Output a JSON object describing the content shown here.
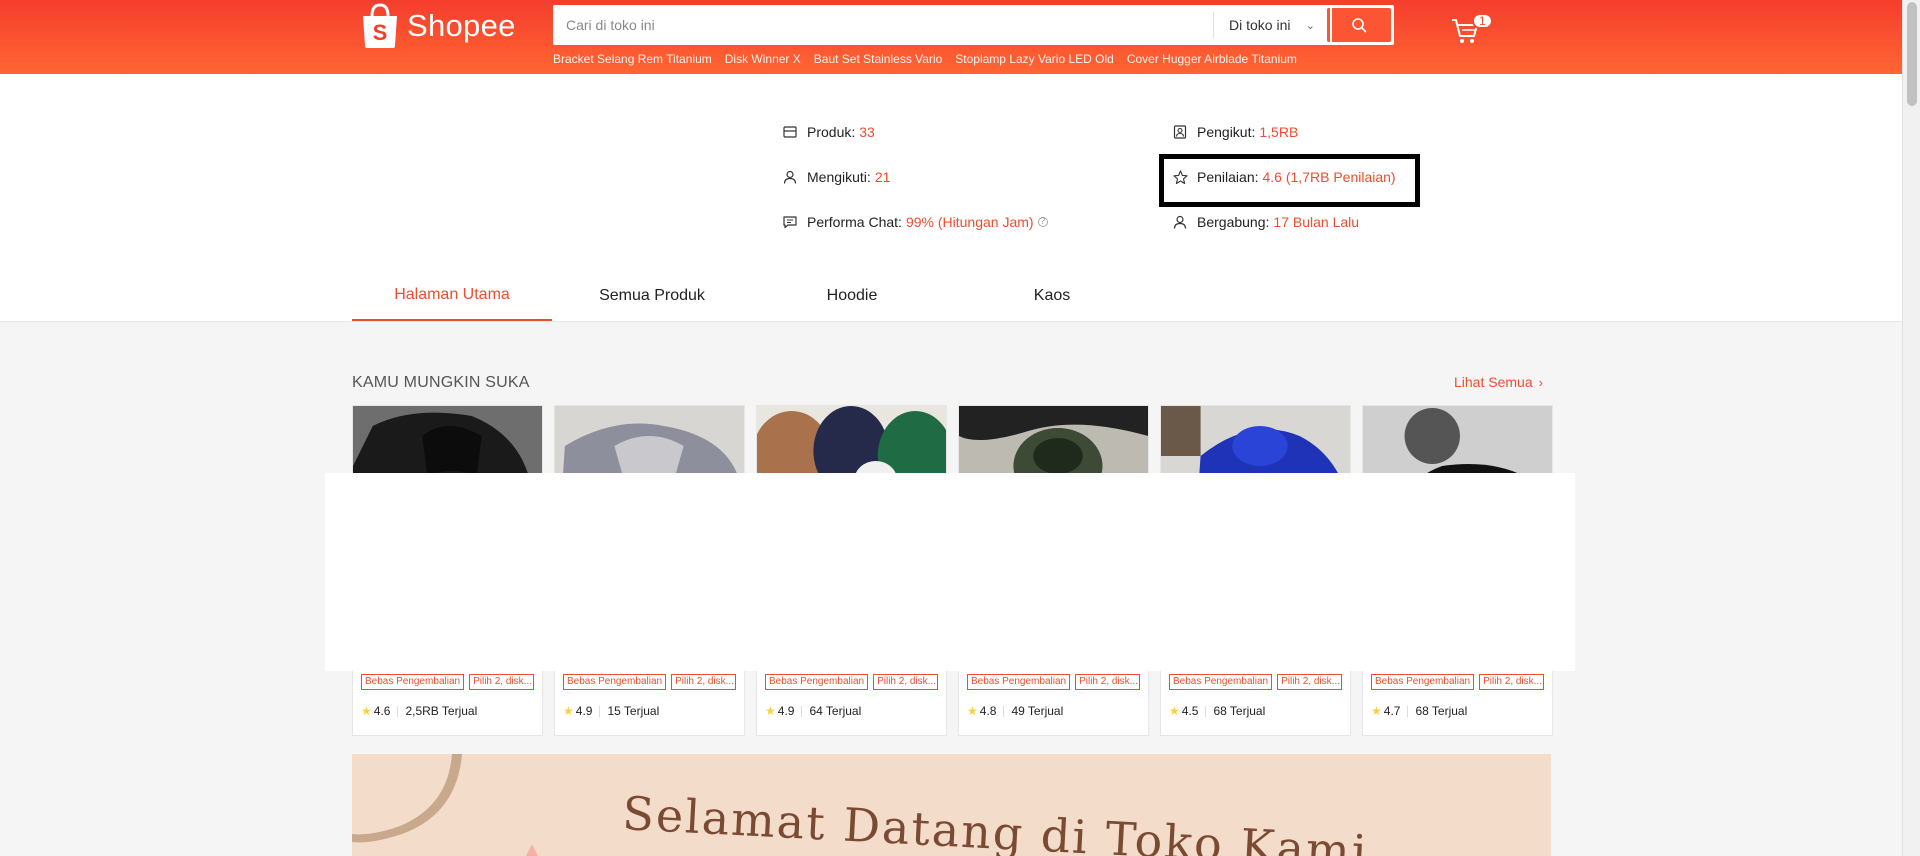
{
  "brand": {
    "name": "Shopee",
    "primary_color": "#ee4d2d"
  },
  "search": {
    "placeholder": "Cari di toko ini",
    "scope_label": "Di toko ini",
    "suggestions": [
      "Bracket Selang Rem Titanium",
      "Disk Winner X",
      "Baut Set Stainless Vario",
      "Stoplamp Lazy Vario LED Old",
      "Cover Hugger Airblade Titanium"
    ]
  },
  "cart": {
    "count": "1"
  },
  "shop_stats": {
    "products": {
      "label": "Produk:",
      "value": "33",
      "icon": "store-icon"
    },
    "following": {
      "label": "Mengikuti:",
      "value": "21",
      "icon": "user-icon"
    },
    "chat_performance": {
      "label": "Performa Chat:",
      "value": "99% (Hitungan Jam)",
      "icon": "chat-icon"
    },
    "followers": {
      "label": "Pengikut:",
      "value": "1,5RB",
      "icon": "followers-icon"
    },
    "rating": {
      "label": "Penilaian:",
      "value": "4.6 (1,7RB Penilaian)",
      "icon": "star-outline-icon"
    },
    "joined": {
      "label": "Bergabung:",
      "value": "17 Bulan Lalu",
      "icon": "user-join-icon"
    }
  },
  "tabs": [
    {
      "label": "Halaman Utama",
      "active": true
    },
    {
      "label": "Semua Produk",
      "active": false
    },
    {
      "label": "Hoodie",
      "active": false
    },
    {
      "label": "Kaos",
      "active": false
    }
  ],
  "recommendations": {
    "title": "KAMU MUNGKIN SUKA",
    "see_all": "Lihat Semua",
    "products": [
      {
        "rating": "4.6",
        "sold": "2,5RB Terjual",
        "tag1": "Bebas Pengembalian",
        "tag2": "Pilih 2, disk..."
      },
      {
        "rating": "4.9",
        "sold": "15 Terjual",
        "tag1": "Bebas Pengembalian",
        "tag2": "Pilih 2, disk..."
      },
      {
        "rating": "4.9",
        "sold": "64 Terjual",
        "tag1": "Bebas Pengembalian",
        "tag2": "Pilih 2, disk..."
      },
      {
        "rating": "4.8",
        "sold": "49 Terjual",
        "tag1": "Bebas Pengembalian",
        "tag2": "Pilih 2, disk..."
      },
      {
        "rating": "4.5",
        "sold": "68 Terjual",
        "tag1": "Bebas Pengembalian",
        "tag2": "Pilih 2, disk..."
      },
      {
        "rating": "4.7",
        "sold": "68 Terjual",
        "tag1": "Bebas Pengembalian",
        "tag2": "Pilih 2, disk..."
      }
    ]
  },
  "banner": {
    "text": "Selamat Datang di Toko Kami"
  }
}
